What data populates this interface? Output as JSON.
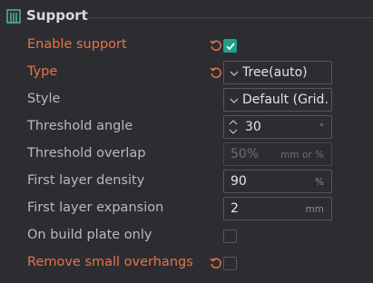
{
  "section": {
    "title": "Support",
    "icon": "support-icon"
  },
  "rows": {
    "enable_support": {
      "label": "Enable support",
      "checked": true
    },
    "type": {
      "label": "Type",
      "value": "Tree(auto)"
    },
    "style": {
      "label": "Style",
      "value": "Default (Grid/Organic)",
      "display": "Default (Grid..."
    },
    "threshold_angle": {
      "label": "Threshold angle",
      "value": "30",
      "unit": "°"
    },
    "threshold_overlap": {
      "label": "Threshold overlap",
      "value": "50%",
      "unit": "mm or %"
    },
    "first_layer_density": {
      "label": "First layer density",
      "value": "90",
      "unit": "%"
    },
    "first_layer_expansion": {
      "label": "First layer expansion",
      "value": "2",
      "unit": "mm"
    },
    "on_build_plate_only": {
      "label": "On build plate only",
      "checked": false
    },
    "remove_small_overhangs": {
      "label": "Remove small overhangs",
      "checked": false
    }
  },
  "colors": {
    "modified_label": "#e4754a",
    "accent": "#1e9f8d",
    "background": "#2d2d31"
  }
}
